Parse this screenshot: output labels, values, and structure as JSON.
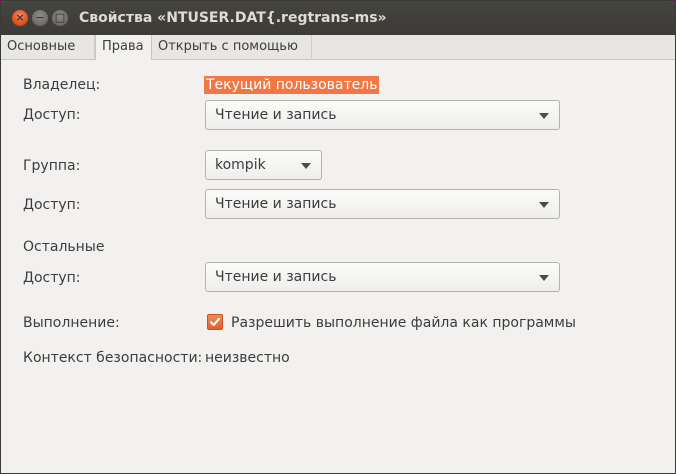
{
  "window": {
    "title": "Свойства «NTUSER.DAT{.regtrans-ms»",
    "close_glyph": "×",
    "minimize_glyph": "−",
    "maximize_glyph": "□"
  },
  "tabs": [
    {
      "label": "Основные",
      "active": false
    },
    {
      "label": "Права",
      "active": true
    },
    {
      "label": "Открыть с помощью",
      "active": false
    }
  ],
  "owner": {
    "label": "Владелец:",
    "value": "Текущий пользователь",
    "access_label": "Доступ:",
    "access_value": "Чтение и запись"
  },
  "group": {
    "label": "Группа:",
    "value": "kompik",
    "access_label": "Доступ:",
    "access_value": "Чтение и запись"
  },
  "others": {
    "label": "Остальные",
    "access_label": "Доступ:",
    "access_value": "Чтение и запись"
  },
  "execute": {
    "label": "Выполнение:",
    "checkbox_label": "Разрешить выполнение файла как программы",
    "checked": true
  },
  "security": {
    "label": "Контекст безопасности:",
    "value": "неизвестно"
  },
  "icons": {
    "dropdown": "chevron-down-icon",
    "check": "check-icon"
  },
  "colors": {
    "accent": "#e95420",
    "highlight": "#f07746",
    "titlebar": "#3c3b37",
    "window_bg": "#f2f1f0"
  }
}
